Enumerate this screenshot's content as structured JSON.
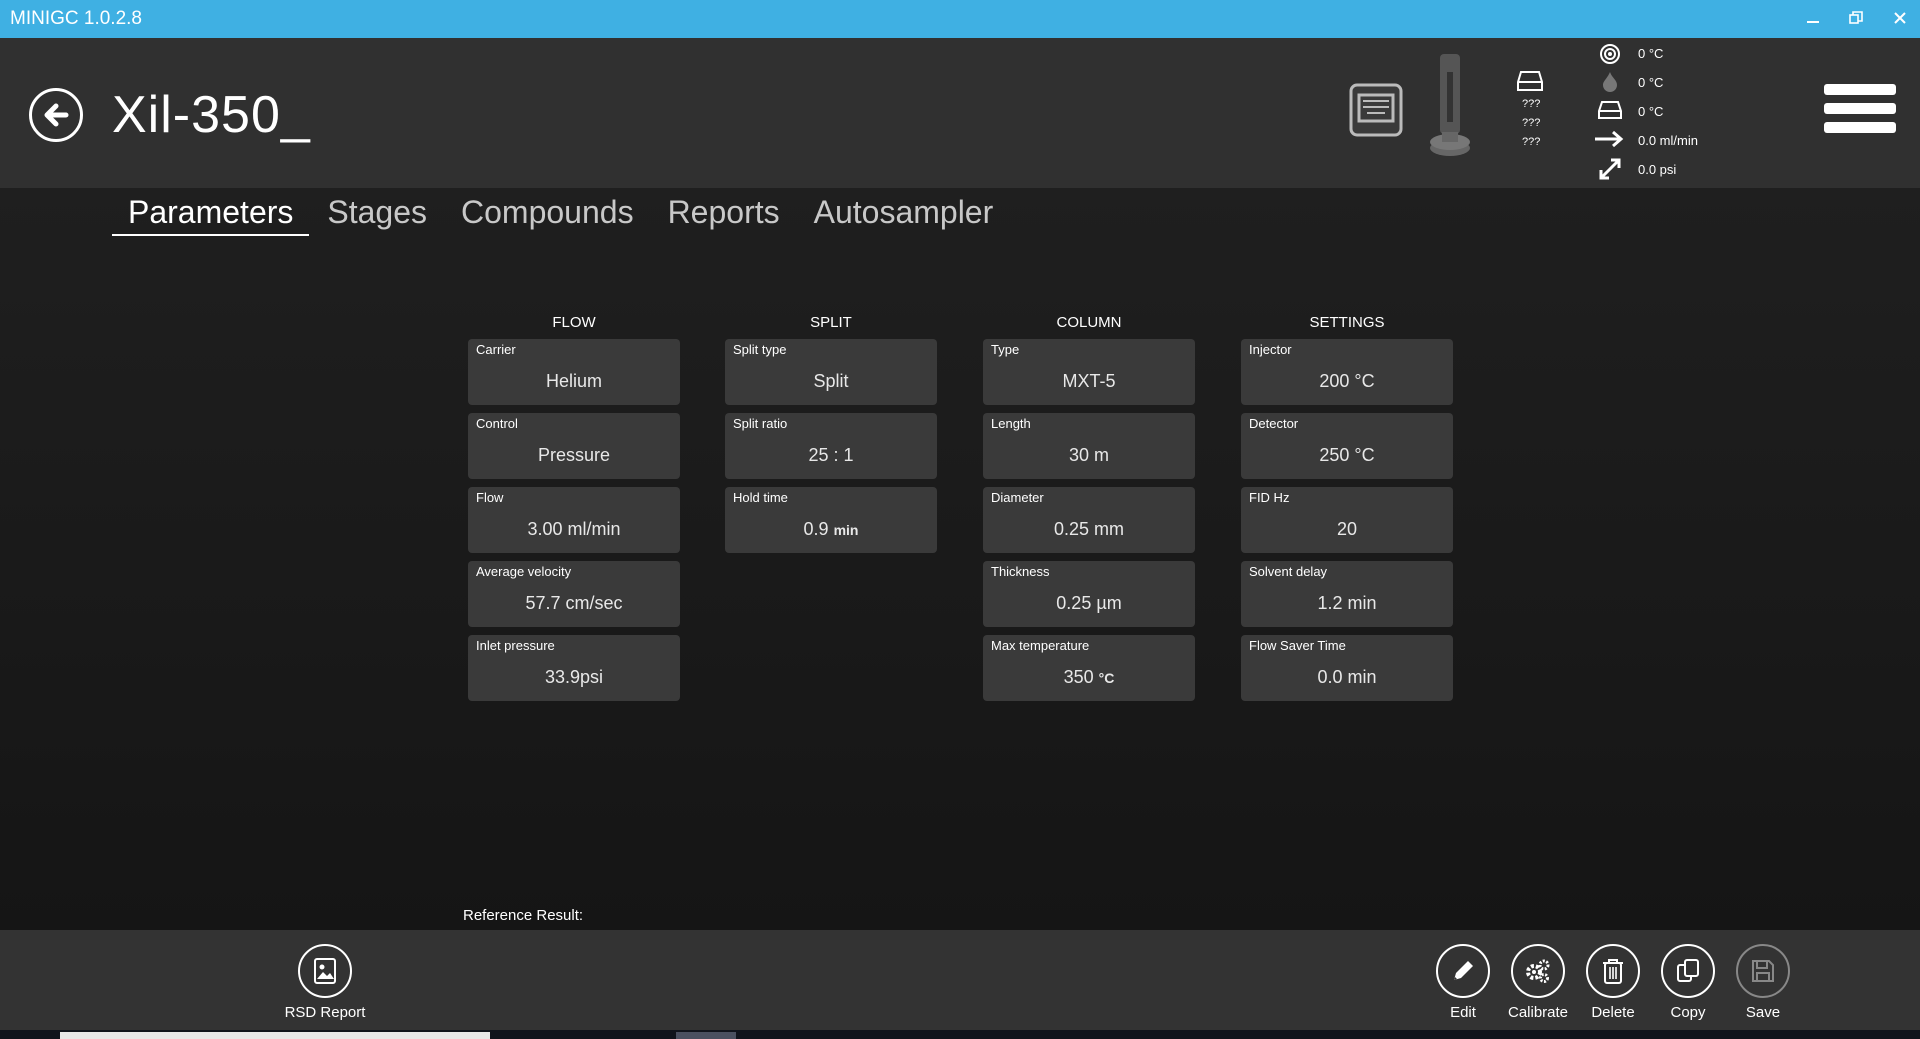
{
  "window": {
    "title": "MINIGC 1.0.2.8"
  },
  "header": {
    "title": "Xil-350_",
    "unknown_values": [
      "???",
      "???",
      "???"
    ],
    "status": [
      {
        "icon": "target-icon",
        "value": "0 °C"
      },
      {
        "icon": "flame-icon",
        "value": "0 °C"
      },
      {
        "icon": "injector-icon",
        "value": "0 °C"
      },
      {
        "icon": "arrow-right-icon",
        "value": "0.0 ml/min"
      },
      {
        "icon": "expand-arrow-icon",
        "value": "0.0  psi"
      }
    ]
  },
  "tabs": [
    "Parameters",
    "Stages",
    "Compounds",
    "Reports",
    "Autosampler"
  ],
  "active_tab": "Parameters",
  "flow": {
    "heading": "FLOW",
    "carrier_label": "Carrier",
    "carrier": "Helium",
    "control_label": "Control",
    "control": "Pressure",
    "flow_label": "Flow",
    "flow": "3.00 ml/min",
    "velocity_label": "Average velocity",
    "velocity": "57.7 cm/sec",
    "pressure_label": "Inlet pressure",
    "pressure": "33.9psi"
  },
  "split": {
    "heading": "SPLIT",
    "type_label": "Split type",
    "type": "Split",
    "ratio_label": "Split ratio",
    "ratio": "25 : 1",
    "hold_label": "Hold time",
    "hold_value": "0.9",
    "hold_unit": "min"
  },
  "column": {
    "heading": "COLUMN",
    "type_label": "Type",
    "type": "MXT-5",
    "length_label": "Length",
    "length": "30 m",
    "diameter_label": "Diameter",
    "diameter": "0.25 mm",
    "thickness_label": "Thickness",
    "thickness": "0.25 µm",
    "maxtemp_label": "Max temperature",
    "maxtemp_value": "350",
    "maxtemp_unit": "°C"
  },
  "settings": {
    "heading": "SETTINGS",
    "injector_label": "Injector",
    "injector": "200 °C",
    "detector_label": "Detector",
    "detector": "250 °C",
    "fid_label": "FID Hz",
    "fid": "20",
    "solvent_label": "Solvent delay",
    "solvent": "1.2 min",
    "saver_label": "Flow Saver Time",
    "saver": "0.0 min"
  },
  "reference_result": "Reference Result:",
  "footer": {
    "rsd": "RSD Report",
    "edit": "Edit",
    "calibrate": "Calibrate",
    "delete": "Delete",
    "copy": "Copy",
    "save": "Save"
  }
}
